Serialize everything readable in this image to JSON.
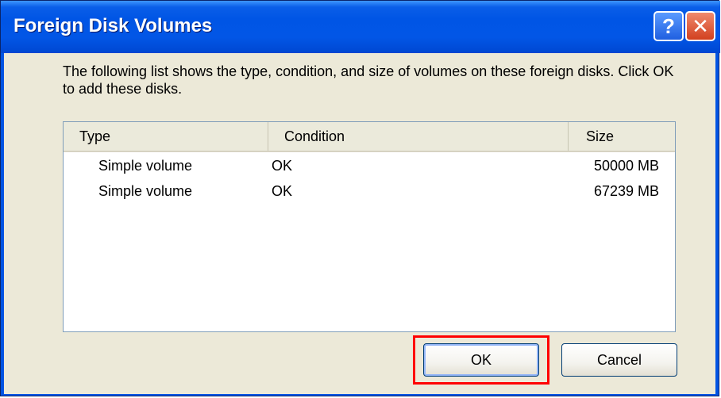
{
  "window": {
    "title": "Foreign Disk Volumes",
    "help_label": "?",
    "close_label": "✕"
  },
  "description": "The following list shows the type, condition, and size of volumes on these foreign disks. Click OK to add these disks.",
  "list": {
    "columns": [
      "Type",
      "Condition",
      "Size"
    ],
    "rows": [
      {
        "type": "Simple volume",
        "condition": "OK",
        "size": "50000 MB"
      },
      {
        "type": "Simple volume",
        "condition": "OK",
        "size": "67239 MB"
      }
    ]
  },
  "buttons": {
    "ok_label": "OK",
    "cancel_label": "Cancel"
  },
  "colors": {
    "titlebar": "#0054e3",
    "dialog_face": "#ece9d8",
    "highlight": "#ff0000"
  }
}
